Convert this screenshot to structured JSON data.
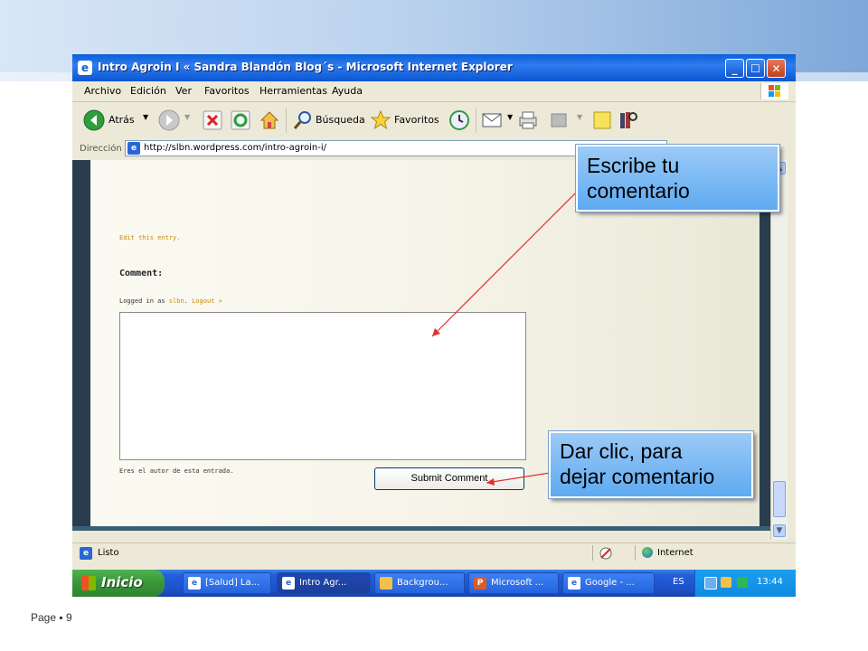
{
  "window": {
    "title": "Intro Agroin I « Sandra Blandón Blog´s - Microsoft Internet Explorer",
    "minimize_glyph": "_",
    "maximize_glyph": "☐",
    "close_glyph": "✕"
  },
  "menu": [
    "Archivo",
    "Edición",
    "Ver",
    "Favoritos",
    "Herramientas",
    "Ayuda"
  ],
  "toolbar": {
    "back": "Atrás",
    "search": "Búsqueda",
    "favorites": "Favoritos"
  },
  "address": {
    "label": "Dirección",
    "url": "http://slbn.wordpress.com/intro-agroin-i/"
  },
  "page": {
    "edit_link": "Edit this entry.",
    "comment_heading": "Comment:",
    "logged_prefix": "Logged in as",
    "logged_user": "slbn",
    "logged_sep": ".",
    "logout": "Logout »",
    "comment_text": "",
    "author_note": "Eres el autor de esta entrada.",
    "submit_label": "Submit Comment"
  },
  "status": {
    "text": "Listo",
    "zone": "Internet"
  },
  "taskbar": {
    "start": "Inicio",
    "tasks": [
      {
        "label": "[Salud] La..."
      },
      {
        "label": "Intro Agr..."
      },
      {
        "label": "Backgrou..."
      },
      {
        "label": "Microsoft ..."
      },
      {
        "label": "Google - ..."
      }
    ],
    "lang": "ES",
    "clock": "13:44"
  },
  "callouts": {
    "write_comment": [
      "Escribe tu",
      "comentario"
    ],
    "click_submit": [
      "Dar clic, para",
      "dejar comentario"
    ]
  },
  "footer": {
    "page_label": "Page",
    "bullet": "▪",
    "page_number": "9"
  }
}
